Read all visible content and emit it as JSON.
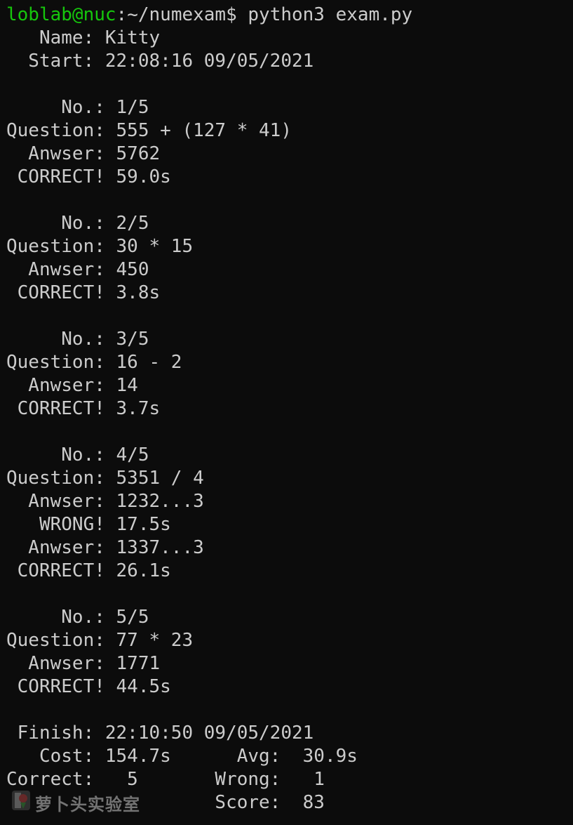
{
  "prompt": {
    "user_host": "loblab@nuc",
    "path": ":~/numexam$ ",
    "command": "python3 exam.py"
  },
  "lines": {
    "name": "   Name: Kitty",
    "start": "  Start: 22:08:16 09/05/2021",
    "q1_no": "     No.: 1/5",
    "q1_question": "Question: 555 + (127 * 41)",
    "q1_answer": "  Anwser: 5762",
    "q1_result": " CORRECT! 59.0s",
    "q2_no": "     No.: 2/5",
    "q2_question": "Question: 30 * 15",
    "q2_answer": "  Anwser: 450",
    "q2_result": " CORRECT! 3.8s",
    "q3_no": "     No.: 3/5",
    "q3_question": "Question: 16 - 2",
    "q3_answer": "  Anwser: 14",
    "q3_result": " CORRECT! 3.7s",
    "q4_no": "     No.: 4/5",
    "q4_question": "Question: 5351 / 4",
    "q4_answer1": "  Anwser: 1232...3",
    "q4_result1": "   WRONG! 17.5s",
    "q4_answer2": "  Anwser: 1337...3",
    "q4_result2": " CORRECT! 26.1s",
    "q5_no": "     No.: 5/5",
    "q5_question": "Question: 77 * 23",
    "q5_answer": "  Anwser: 1771",
    "q5_result": " CORRECT! 44.5s",
    "finish": " Finish: 22:10:50 09/05/2021",
    "cost_avg": "   Cost: 154.7s      Avg:  30.9s",
    "correct_wrong": "Correct:   5       Wrong:   1",
    "score": "                   Score:  83"
  },
  "watermark": {
    "text": "萝卜头实验室",
    "icon": "radish-logo-icon"
  },
  "colors": {
    "background": "#0c0c0c",
    "foreground": "#cccccc",
    "prompt_user": "#16c60c"
  }
}
